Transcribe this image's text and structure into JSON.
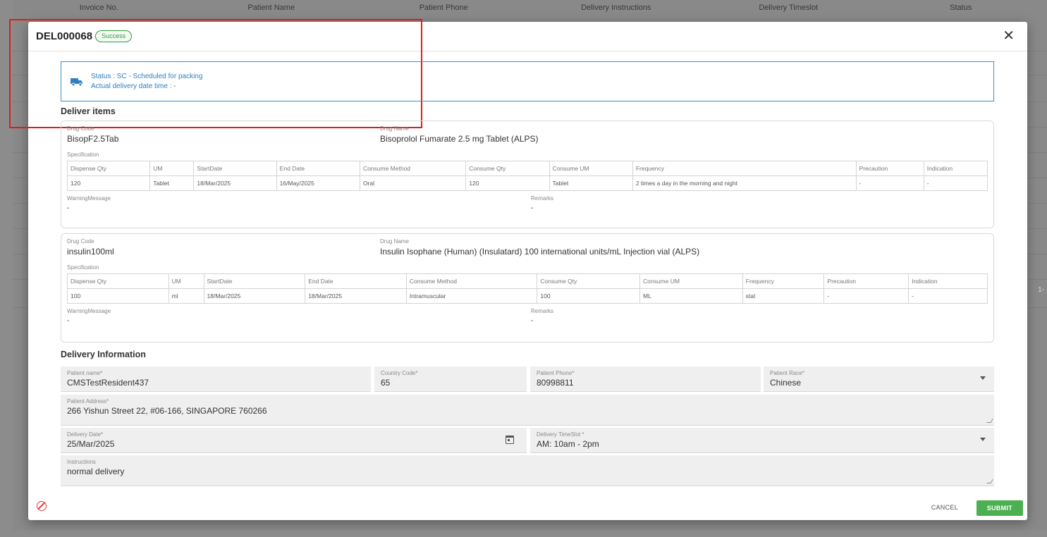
{
  "background": {
    "columns": [
      "Invoice No.",
      "Patient Name",
      "Patient Phone",
      "Delivery Instructions",
      "Delivery Timeslot",
      "Status"
    ],
    "pager": "1-"
  },
  "modal": {
    "title": "DEL000068",
    "badge": "Success",
    "close_icon": "close-icon",
    "status_line": "Status : SC - Scheduled for packing",
    "actual_delivery_line": "Actual delivery date time : -",
    "deliver_items_title": "Deliver items",
    "labels": {
      "drug_code": "Drug Code",
      "drug_name": "Drug Name",
      "specification": "Specification",
      "warning_message": "WarningMessage",
      "remarks": "Remarks"
    },
    "spec_headers": [
      "Dispense Qty",
      "UM",
      "StartDate",
      "End Date",
      "Consume Method",
      "Consume Qty",
      "Consume UM",
      "Frequency",
      "Precaution",
      "Indication"
    ],
    "drugs": [
      {
        "code": "BisopF2.5Tab",
        "name": "Bisoprolol Fumarate 2.5 mg Tablet (ALPS)",
        "row": [
          "120",
          "Tablet",
          "18/Mar/2025",
          "16/May/2025",
          "Oral",
          "120",
          "Tablet",
          "2 times a day in the morning and night",
          "-",
          "-"
        ],
        "warning": "-",
        "remarks": "-"
      },
      {
        "code": "insulin100ml",
        "name": "Insulin Isophane (Human) (Insulatard) 100 international units/mL Injection vial (ALPS)",
        "row": [
          "100",
          "ml",
          "18/Mar/2025",
          "18/Mar/2025",
          "Intramuscular",
          "100",
          "ML",
          "stat",
          "-",
          "-"
        ],
        "warning": "-",
        "remarks": "-"
      }
    ],
    "delivery_info_title": "Delivery Information",
    "fields": {
      "patient_name": {
        "label": "Patient name*",
        "value": "CMSTestResident437"
      },
      "country_code": {
        "label": "Country Code*",
        "value": "65"
      },
      "patient_phone": {
        "label": "Patient Phone*",
        "value": "80998811"
      },
      "patient_race": {
        "label": "Patient Race*",
        "value": "Chinese"
      },
      "patient_address": {
        "label": "Patient Address*",
        "value": "266 Yishun Street 22, #06-166, SINGAPORE 760266"
      },
      "delivery_date": {
        "label": "Delivery Date*",
        "value": "25/Mar/2025"
      },
      "delivery_timeslot": {
        "label": "Delivery TimeSlot *",
        "value": "AM: 10am - 2pm"
      },
      "instructions": {
        "label": "Instructions",
        "value": "normal delivery"
      }
    },
    "cancel_label": "CANCEL",
    "submit_label": "SUBMIT",
    "colors": {
      "accent": "#2f7fc1",
      "success": "#2e9b3c",
      "submit": "#4caf50",
      "danger": "#e03a3a"
    }
  }
}
